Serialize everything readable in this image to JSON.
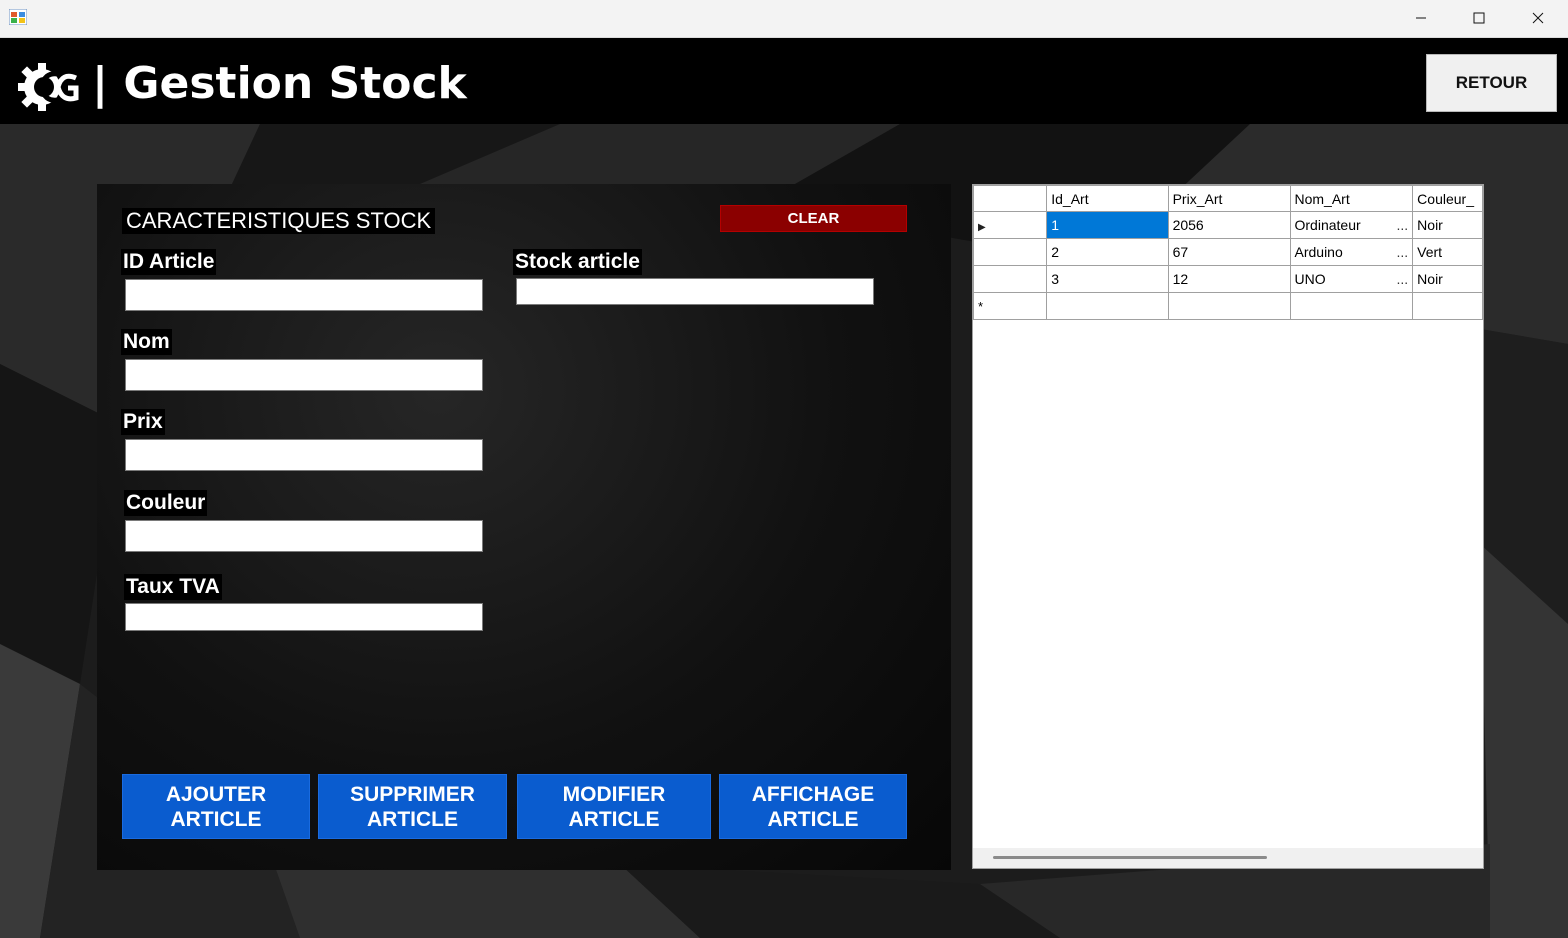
{
  "window": {
    "controls": {
      "minimize": "minimize",
      "maximize": "maximize",
      "close": "close"
    }
  },
  "header": {
    "logo_icon": "gear-gc-logo",
    "title": "| Gestion Stock",
    "back_button": "RETOUR"
  },
  "form": {
    "section_title": "CARACTERISTIQUES STOCK",
    "clear_button": "CLEAR",
    "fields": {
      "id_article": {
        "label": "ID Article",
        "value": ""
      },
      "nom": {
        "label": "Nom",
        "value": ""
      },
      "prix": {
        "label": "Prix",
        "value": ""
      },
      "couleur": {
        "label": "Couleur",
        "value": ""
      },
      "taux_tva": {
        "label": "Taux TVA",
        "value": ""
      },
      "stock_article": {
        "label": "Stock article",
        "value": ""
      }
    },
    "actions": {
      "ajouter": [
        "AJOUTER",
        "ARTICLE"
      ],
      "supprimer": [
        "SUPPRIMER",
        "ARTICLE"
      ],
      "modifier": [
        "MODIFIER",
        "ARTICLE"
      ],
      "affichage": [
        "AFFICHAGE",
        "ARTICLE"
      ]
    }
  },
  "grid": {
    "columns": [
      "Id_Art",
      "Prix_Art",
      "Nom_Art",
      "Couleur_"
    ],
    "rows": [
      {
        "id": "1",
        "prix": "2056",
        "nom": "Ordinateur",
        "couleur": "Noir"
      },
      {
        "id": "2",
        "prix": "67",
        "nom": "Arduino",
        "couleur": "Vert"
      },
      {
        "id": "3",
        "prix": "12",
        "nom": "UNO",
        "couleur": "Noir"
      }
    ],
    "ellipsis": "...",
    "new_row_marker": "*",
    "current_row_marker": "▶",
    "selection_color": "#0078d7"
  },
  "colors": {
    "header_bg": "#000000",
    "clear_button": "#8b0000",
    "action_button": "#0a5ccf"
  }
}
